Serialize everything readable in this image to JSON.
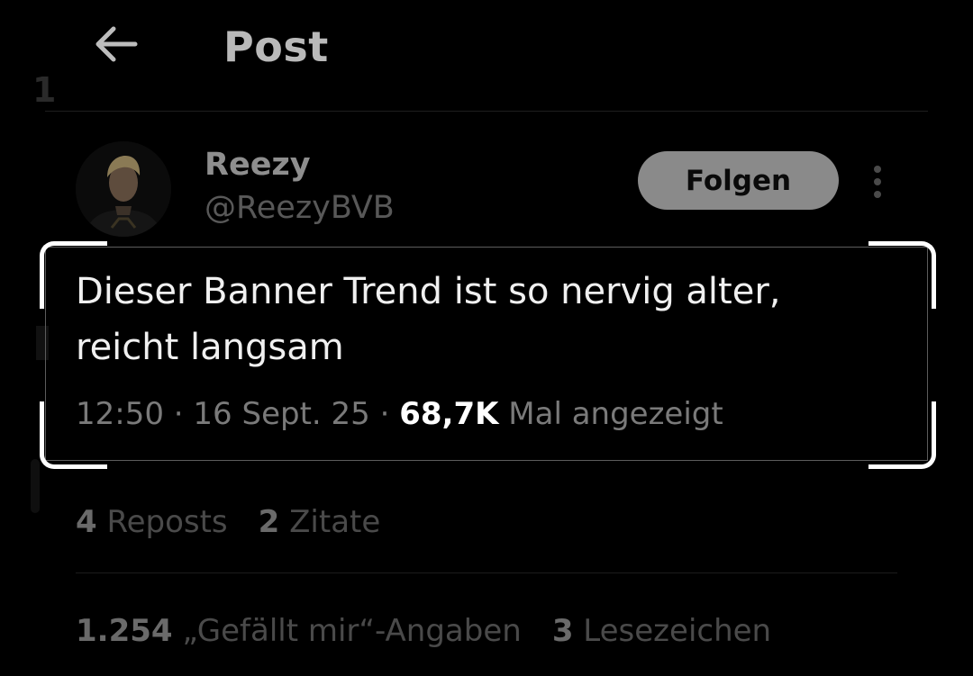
{
  "header": {
    "title": "Post",
    "stray_digit": "1"
  },
  "author": {
    "name": "Reezy",
    "handle": "@ReezyBVB",
    "follow_label": "Folgen"
  },
  "tweet": {
    "text": "Dieser Banner Trend ist so nervig alter,\nreicht langsam",
    "time": "12:50",
    "separator": " · ",
    "date": "16 Sept. 25",
    "views": "68,7K",
    "views_label": " Mal angezeigt"
  },
  "stats": {
    "reposts_count": "4",
    "reposts_label": " Reposts",
    "quotes_count": "2",
    "quotes_label": " Zitate",
    "likes_count": "1.254",
    "likes_label": " „Gefällt mir“-Angaben",
    "bookmarks_count": "3",
    "bookmarks_label": " Lesezeichen"
  },
  "icons": {
    "back": "back-arrow-icon",
    "more": "more-vertical-icon"
  },
  "colors": {
    "background": "#000000",
    "highlight_border": "#ffffff",
    "follow_button": "#8a8a8a"
  }
}
